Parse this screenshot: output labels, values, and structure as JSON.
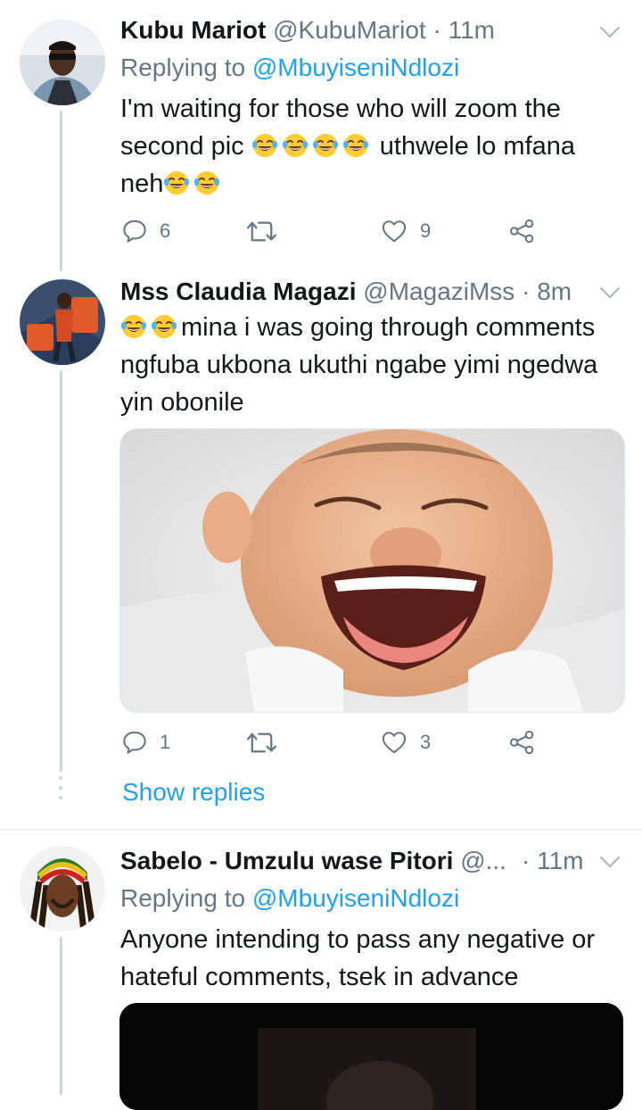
{
  "tweets": [
    {
      "display_name": "Kubu Mariot",
      "handle": "@KubuMariot",
      "separator": "·",
      "time": "11m",
      "replying_label": "Replying to",
      "replying_to": "@MbuyiseniNdlozi",
      "text_line1": "I'm waiting for those who will zoom the",
      "text_line2_a": "second pic",
      "text_line2_b": "uthwele lo mfana",
      "text_line3": "neh",
      "replies": "6",
      "retweets": "",
      "likes": "9"
    },
    {
      "display_name": "Mss Claudia Magazi",
      "handle": "@MagaziMss",
      "separator": "·",
      "time": "8m",
      "text_line1": "mina i was going through comments",
      "text_line2": "ngfuba ukbona ukuthi ngabe yimi ngedwa",
      "text_line3": "yin obonile",
      "media_icon": "laughing-baby-photo",
      "replies": "1",
      "retweets": "",
      "likes": "3",
      "show_replies": "Show replies"
    },
    {
      "display_name": "Sabelo - Umzulu wase Pitori",
      "handle": "@...",
      "separator": "·",
      "time": "11m",
      "replying_label": "Replying to",
      "replying_to": "@MbuyiseniNdlozi",
      "text_line1": "Anyone intending to pass any negative or",
      "text_line2": "hateful comments, tsek in advance",
      "media_icon": "dark-photo"
    }
  ],
  "colors": {
    "accent": "#1da1f2",
    "secondary_text": "#657786",
    "thread_line": "#ccd6dd"
  },
  "icons": [
    "reply-icon",
    "retweet-icon",
    "like-icon",
    "share-icon",
    "chevron-down-icon",
    "tears-of-joy-emoji"
  ]
}
